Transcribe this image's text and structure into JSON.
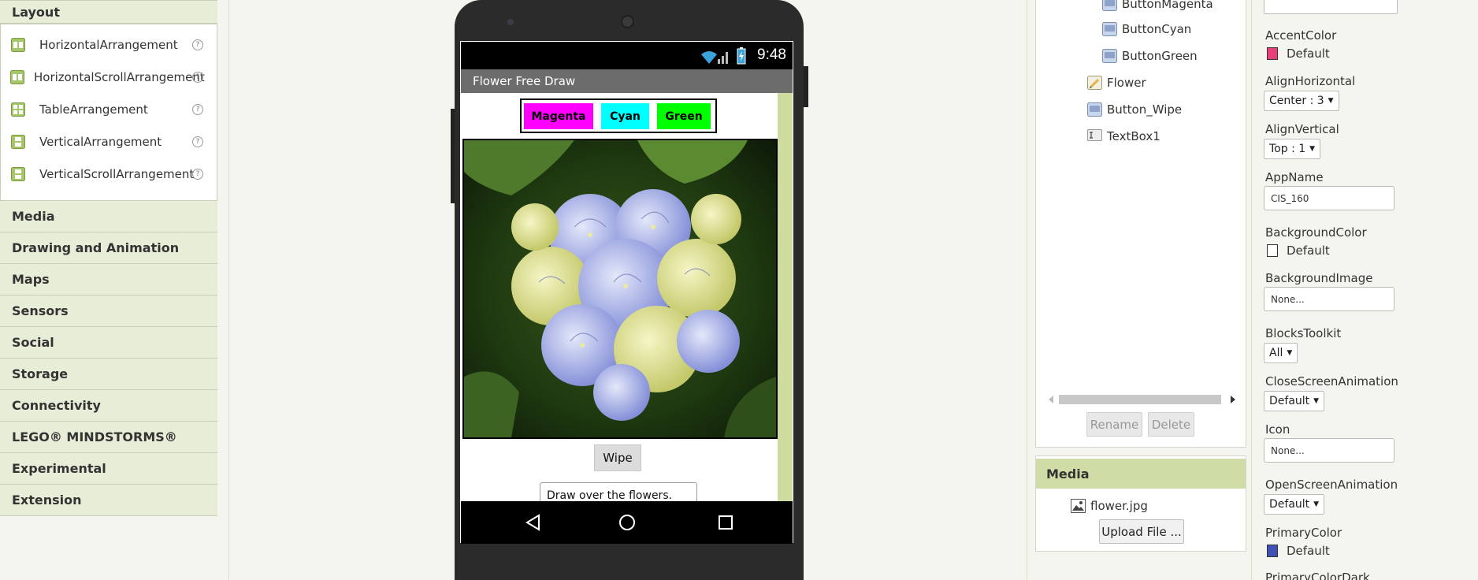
{
  "palette": {
    "layout_header": "Layout",
    "layout_items": [
      "HorizontalArrangement",
      "HorizontalScrollArrangement",
      "TableArrangement",
      "VerticalArrangement",
      "VerticalScrollArrangement"
    ],
    "help_glyph": "?",
    "categories": [
      "Media",
      "Drawing and Animation",
      "Maps",
      "Sensors",
      "Social",
      "Storage",
      "Connectivity",
      "LEGO® MINDSTORMS®",
      "Experimental",
      "Extension"
    ]
  },
  "phone": {
    "status_time": "9:48",
    "screen_title": "Flower Free Draw",
    "buttons": [
      {
        "label": "Magenta",
        "color": "#ff00ff"
      },
      {
        "label": "Cyan",
        "color": "#00ffff"
      },
      {
        "label": "Green",
        "color": "#00ff00"
      }
    ],
    "wipe_label": "Wipe",
    "textbox_value": "Draw over the flowers.",
    "sidebar_color": "#cfdc9f"
  },
  "components": {
    "items": [
      "ButtonMagenta",
      "ButtonCyan",
      "ButtonGreen",
      "Flower",
      "Button_Wipe",
      "TextBox1"
    ],
    "rename_label": "Rename",
    "delete_label": "Delete"
  },
  "media": {
    "header": "Media",
    "file": "flower.jpg",
    "upload_label": "Upload File ..."
  },
  "properties": {
    "accent_color_label": "AccentColor",
    "accent_color_value": "Default",
    "accent_color_swatch": "#e8407a",
    "align_horizontal_label": "AlignHorizontal",
    "align_horizontal_value": "Center : 3",
    "align_vertical_label": "AlignVertical",
    "align_vertical_value": "Top : 1",
    "app_name_label": "AppName",
    "app_name_value": "CIS_160",
    "background_color_label": "BackgroundColor",
    "background_color_value": "Default",
    "background_image_label": "BackgroundImage",
    "background_image_value": "None...",
    "blocks_toolkit_label": "BlocksToolkit",
    "blocks_toolkit_value": "All",
    "close_anim_label": "CloseScreenAnimation",
    "close_anim_value": "Default",
    "icon_label": "Icon",
    "icon_value": "None...",
    "open_anim_label": "OpenScreenAnimation",
    "open_anim_value": "Default",
    "primary_color_label": "PrimaryColor",
    "primary_color_value": "Default",
    "primary_color_swatch": "#3f51b5",
    "primary_color_dark_label": "PrimaryColorDark"
  }
}
